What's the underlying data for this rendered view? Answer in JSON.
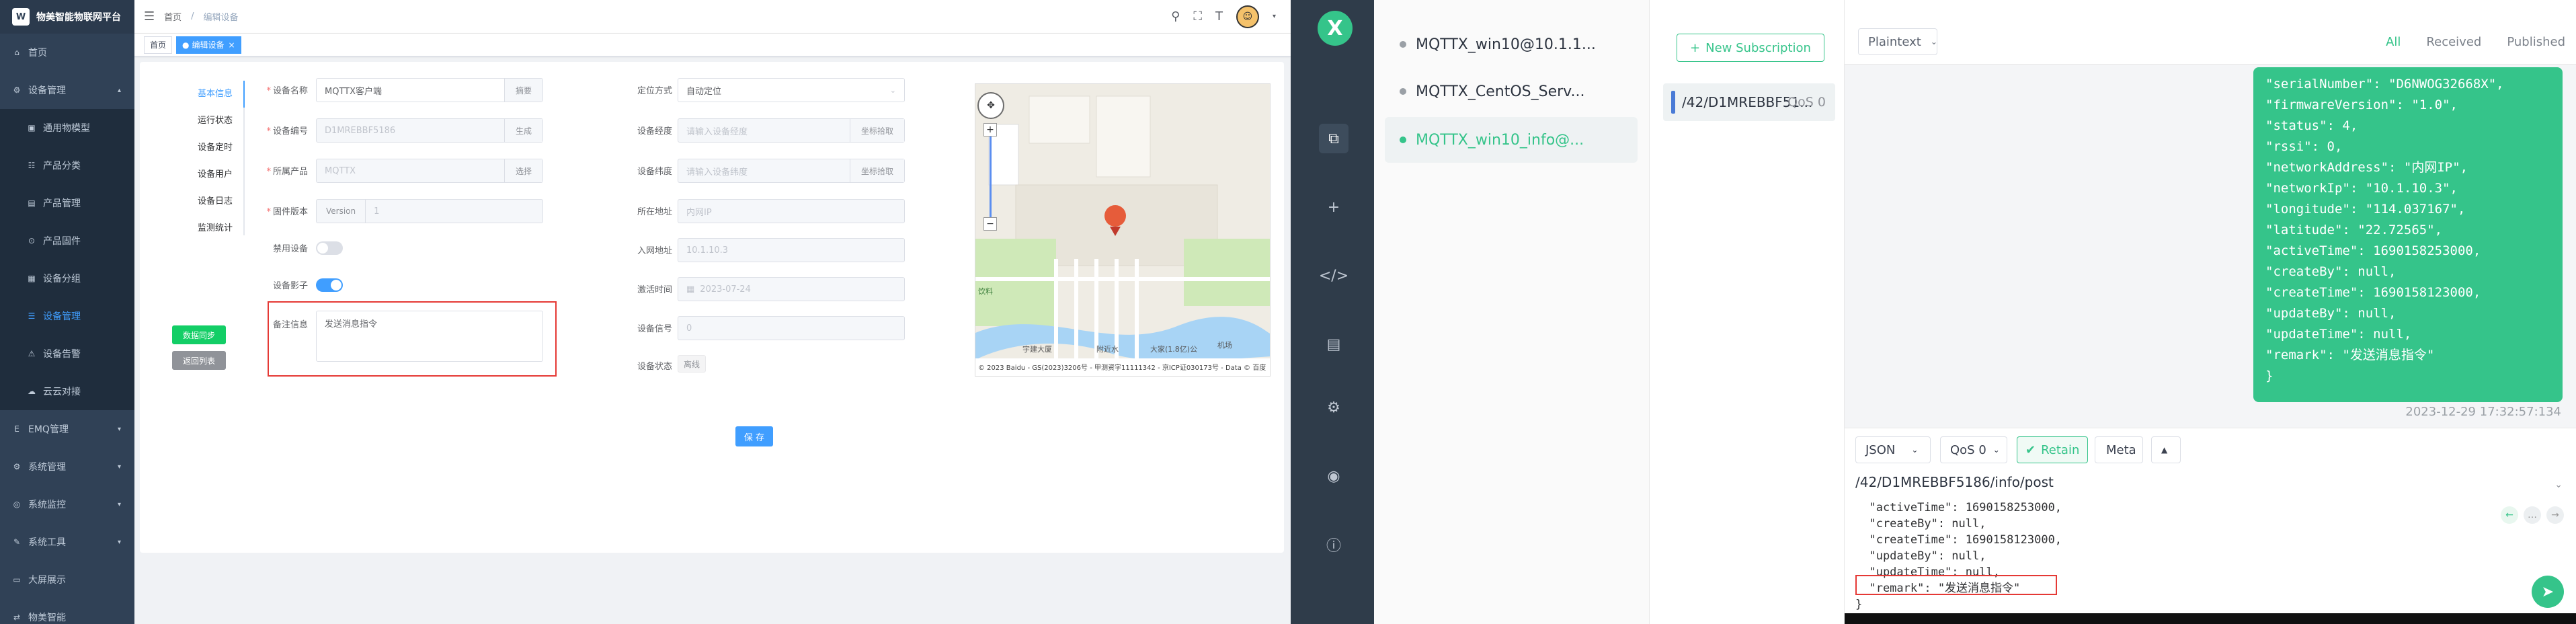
{
  "app": {
    "title": "物美智能物联网平台",
    "logo": "W"
  },
  "sidebar": {
    "items": [
      {
        "label": "首页",
        "icon": "home-icon",
        "level": 0,
        "active": false
      },
      {
        "label": "设备管理",
        "icon": "device-icon",
        "level": 0,
        "active": false,
        "arrow": "▴"
      },
      {
        "label": "通用物模型",
        "icon": "model-icon",
        "level": 1,
        "active": false
      },
      {
        "label": "产品分类",
        "icon": "tree-icon",
        "level": 1,
        "active": false
      },
      {
        "label": "产品管理",
        "icon": "product-icon",
        "level": 1,
        "active": false
      },
      {
        "label": "产品固件",
        "icon": "firmware-icon",
        "level": 1,
        "active": false
      },
      {
        "label": "设备分组",
        "icon": "group-icon",
        "level": 1,
        "active": false
      },
      {
        "label": "设备管理",
        "icon": "list-icon",
        "level": 1,
        "active": true
      },
      {
        "label": "设备告警",
        "icon": "alarm-icon",
        "level": 1,
        "active": false
      },
      {
        "label": "云云对接",
        "icon": "cloud-icon",
        "level": 1,
        "active": false
      },
      {
        "label": "EMQ管理",
        "icon": "emq-icon",
        "level": 0,
        "active": false,
        "arrow": "▾"
      },
      {
        "label": "系统管理",
        "icon": "system-icon",
        "level": 0,
        "active": false,
        "arrow": "▾"
      },
      {
        "label": "系统监控",
        "icon": "monitor-icon",
        "level": 0,
        "active": false,
        "arrow": "▾"
      },
      {
        "label": "系统工具",
        "icon": "tool-icon",
        "level": 0,
        "active": false,
        "arrow": "▾"
      },
      {
        "label": "大屏展示",
        "icon": "screen-icon",
        "level": 0,
        "active": false
      },
      {
        "label": "物美智能",
        "icon": "link-icon",
        "level": 0,
        "active": false
      }
    ]
  },
  "header": {
    "crumbs": [
      "首页",
      "编辑设备"
    ],
    "sep": "/"
  },
  "tags": {
    "home": "首页",
    "current": "编辑设备",
    "close": "×"
  },
  "vtabs": [
    "基本信息",
    "运行状态",
    "设备定时",
    "设备用户",
    "设备日志",
    "监测统计"
  ],
  "buttons": {
    "sync": "数据同步",
    "back": "返回列表",
    "save": "保 存"
  },
  "form": {
    "name_label": "设备名称",
    "name_value": "MQTTX客户端",
    "name_suffix": "摘要",
    "serial_label": "设备编号",
    "serial_value": "D1MREBBF5186",
    "serial_suffix": "生成",
    "product_label": "所属产品",
    "product_value": "MQTTX",
    "product_suffix": "选择",
    "firmware_label": "固件版本",
    "firmware_prefix": "Version",
    "firmware_value": "1",
    "disable_label": "禁用设备",
    "shadow_label": "设备影子",
    "remark_label": "备注信息",
    "remark_value": "发送消息指令",
    "locate_label": "定位方式",
    "locate_value": "自动定位",
    "lng_label": "设备经度",
    "lng_placeholder": "请输入设备经度",
    "lng_suffix": "坐标拾取",
    "lat_label": "设备纬度",
    "lat_placeholder": "请输入设备纬度",
    "lat_suffix": "坐标拾取",
    "addr_label": "所在地址",
    "addr_value": "内网IP",
    "ip_label": "入网地址",
    "ip_value": "10.1.10.3",
    "active_label": "激活时间",
    "active_value": "2023-07-24",
    "rssi_label": "设备信号",
    "rssi_value": "0",
    "status_label": "设备状态",
    "status_value": "离线"
  },
  "map": {
    "footer": "© 2023 Baidu - GS(2023)3206号 - 甲测资字11111342 - 京ICP证030173号 - Data © 百度",
    "label1": "饮料",
    "label2": "宇建大厦",
    "label3": "附近水",
    "label4": "大家(1.8亿)公",
    "label5": "机场"
  },
  "mqttx": {
    "logo": "X",
    "connections": [
      {
        "name": "MQTTX_win10@10.1.1...",
        "active": false
      },
      {
        "name": "MQTTX_CentOS_Serv...",
        "active": false
      },
      {
        "name": "MQTTX_win10_info@...",
        "active": true
      }
    ],
    "new_sub": "New Subscription",
    "subscription": {
      "topic": "/42/D1MREBBF51...",
      "qos": "QoS 0"
    },
    "format": "Plaintext",
    "filters": [
      "All",
      "Received",
      "Published"
    ],
    "message_lines": [
      "\"serialNumber\": \"D6NWOG32668X\",",
      "\"firmwareVersion\": \"1.0\",",
      "\"status\": 4,",
      "\"rssi\": 0,",
      "\"networkAddress\": \"内网IP\",",
      "\"networkIp\": \"10.1.10.3\",",
      "\"longitude\": \"114.037167\",",
      "\"latitude\": \"22.72565\",",
      "\"activeTime\": 1690158253000,",
      "\"createBy\": null,",
      "\"createTime\": 1690158123000,",
      "\"updateBy\": null,",
      "\"updateTime\": null,",
      "\"remark\": \"发送消息指令\"",
      "}"
    ],
    "timestamp": "2023-12-29 17:32:57:134",
    "payload_type": "JSON",
    "qos": "QoS 0",
    "retain": "Retain",
    "meta": "Meta",
    "publish_topic": "/42/D1MREBBF5186/info/post",
    "code_lines": [
      "  \"activeTime\": 1690158253000,",
      "  \"createBy\": null,",
      "  \"createTime\": 1690158123000,",
      "  \"updateBy\": null,",
      "  \"updateTime\": null,",
      "  \"remark\": \"发送消息指令\"",
      "}"
    ]
  }
}
